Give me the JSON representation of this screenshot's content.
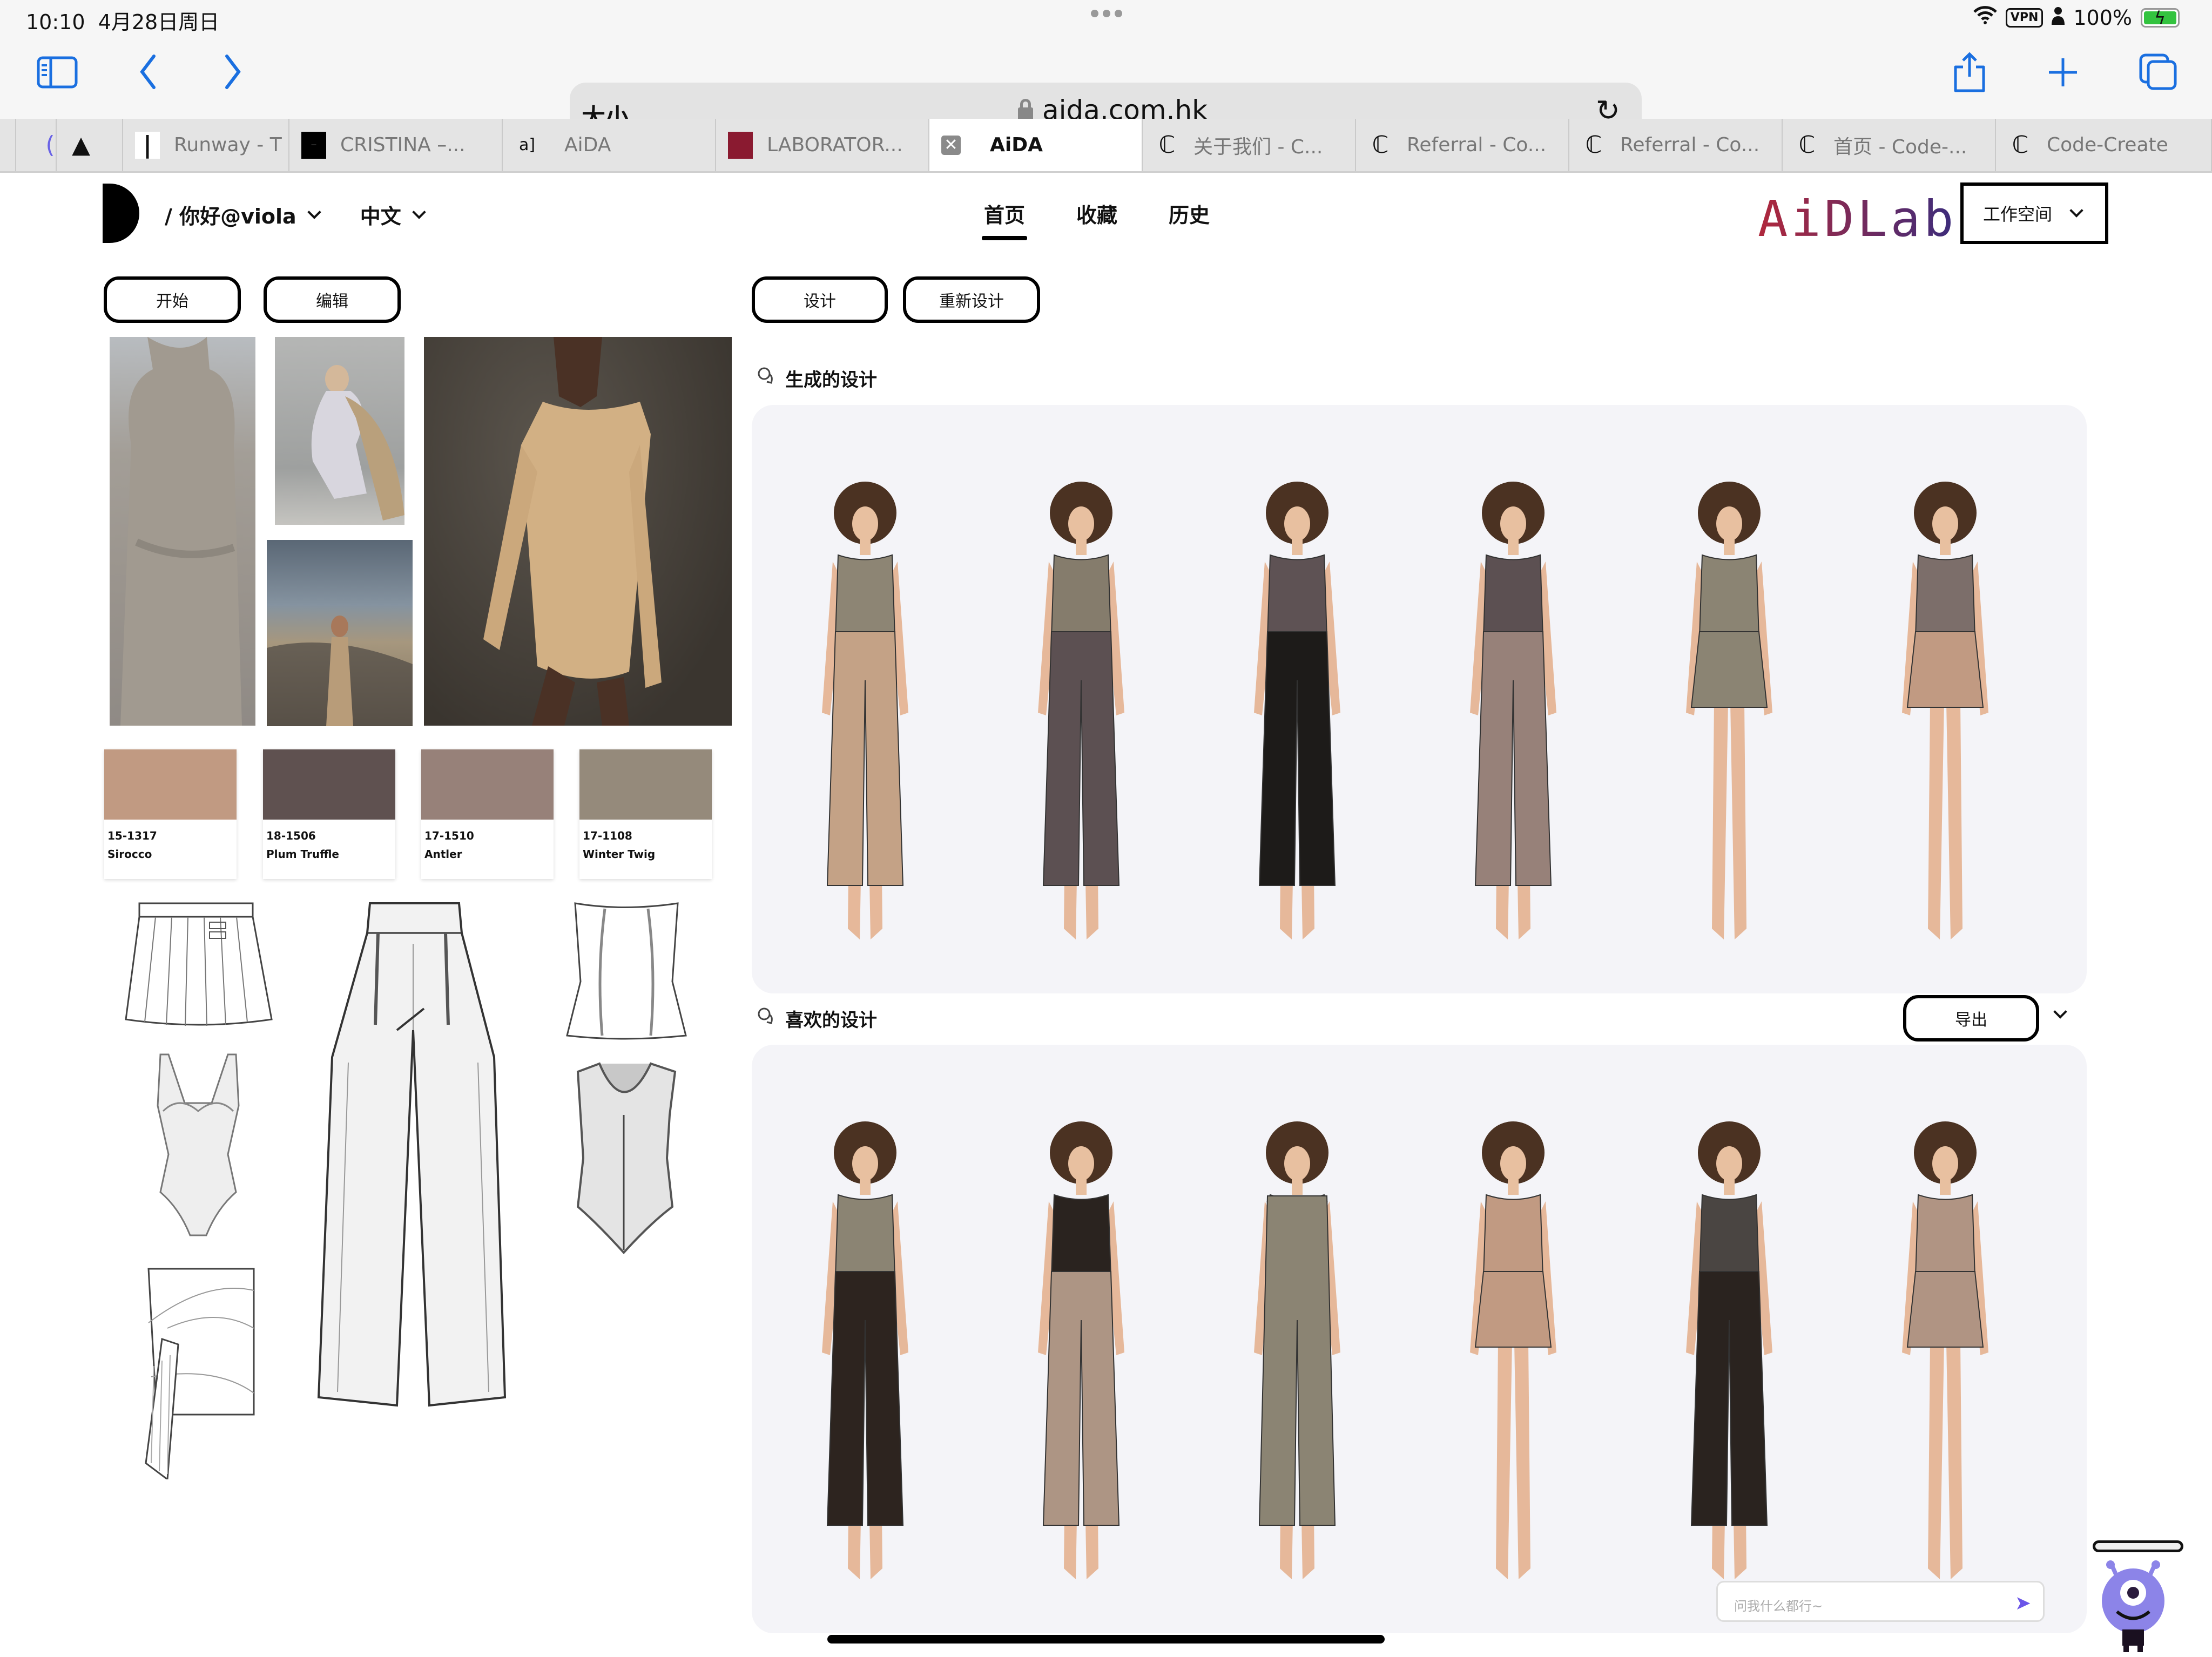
{
  "status_bar": {
    "time": "10:10",
    "date": "4月28日周日",
    "vpn": "VPN",
    "battery": "100%"
  },
  "browser": {
    "size_label": "大小",
    "url": "aida.com.hk",
    "icons": [
      "sidebar-icon",
      "back-icon",
      "forward-icon",
      "lock-icon",
      "reload-icon",
      "share-icon",
      "new-tab-icon",
      "tabs-overview-icon"
    ]
  },
  "tabs": [
    {
      "label": "",
      "favicon": "purple-c"
    },
    {
      "label": "",
      "favicon": "triangle"
    },
    {
      "label": "Runway - T",
      "favicon": "runway"
    },
    {
      "label": "CRISTINA –...",
      "favicon": "black-square"
    },
    {
      "label": "AiDA",
      "favicon": "aida"
    },
    {
      "label": "LABORATOR...",
      "favicon": "red-square"
    },
    {
      "label": "AiDA",
      "favicon": "close",
      "active": true
    },
    {
      "label": "关于我们 - C...",
      "favicon": "c"
    },
    {
      "label": "Referral - Co...",
      "favicon": "c"
    },
    {
      "label": "Referral - Co...",
      "favicon": "c"
    },
    {
      "label": "首页 - Code-...",
      "favicon": "c"
    },
    {
      "label": "Code-Create",
      "favicon": "c"
    }
  ],
  "header": {
    "user": "/ 你好@viola",
    "language": "中文",
    "nav": [
      {
        "label": "首页",
        "active": true
      },
      {
        "label": "收藏",
        "active": false
      },
      {
        "label": "历史",
        "active": false
      }
    ],
    "brand": "AiDLab",
    "workspace": "工作空间"
  },
  "left": {
    "start_button": "开始",
    "edit_button": "编辑",
    "moodboard": [
      "knit-dress-photo",
      "crouching-model-photo",
      "beach-model-photo",
      "ribbed-dress-photo"
    ],
    "swatches": [
      {
        "code": "15-1317",
        "name": "Sirocco",
        "color": "#c19a82"
      },
      {
        "code": "18-1506",
        "name": "Plum Truffle",
        "color": "#5f5150"
      },
      {
        "code": "17-1510",
        "name": "Antler",
        "color": "#978179"
      },
      {
        "code": "17-1108",
        "name": "Winter Twig",
        "color": "#958a7b"
      }
    ],
    "sketches": [
      "pleated-skirt",
      "wide-leg-trousers",
      "strapless-corset-top",
      "lace-bodysuit",
      "scoop-bodysuit",
      "draped-wrap-skirt"
    ]
  },
  "right": {
    "design_button": "设计",
    "redesign_button": "重新设计",
    "generated_title": "生成的设计",
    "favorites_title": "喜欢的设计",
    "export_button": "导出",
    "generated": [
      {
        "top": "#8d8574",
        "bottom": "#c4a286",
        "style": "cropped-shirt-culottes"
      },
      {
        "top": "#857c6c",
        "bottom": "#5c5052",
        "style": "vest-wide-pants"
      },
      {
        "top": "#5e5254",
        "bottom": "#1d1b19",
        "style": "moto-jacket-slim-pants"
      },
      {
        "top": "#5c5052",
        "bottom": "#978179",
        "style": "draped-top-trousers"
      },
      {
        "top": "#8b8473",
        "bottom": "#8b8473",
        "style": "top-pleated-skirt"
      },
      {
        "top": "#7c6e6a",
        "bottom": "#c19a82",
        "style": "lace-bodysuit-wrap"
      }
    ],
    "favorites": [
      {
        "top": "#8b8473",
        "bottom": "#2d241f",
        "style": "crop-top-wide-pants"
      },
      {
        "top": "#2a231f",
        "bottom": "#ad9584",
        "style": "bodysuit-wide-pants"
      },
      {
        "top": "#8b8473",
        "bottom": "#8b8473",
        "style": "long-dress"
      },
      {
        "top": "#c19a82",
        "bottom": "#c19a82",
        "style": "dotted-top-skirt"
      },
      {
        "top": "#4a4542",
        "bottom": "#2a231f",
        "style": "tank-flare-pants"
      },
      {
        "top": "#b09483",
        "bottom": "#b09483",
        "style": "lace-bodysuit"
      }
    ],
    "chat_placeholder": "问我什么都行~"
  }
}
